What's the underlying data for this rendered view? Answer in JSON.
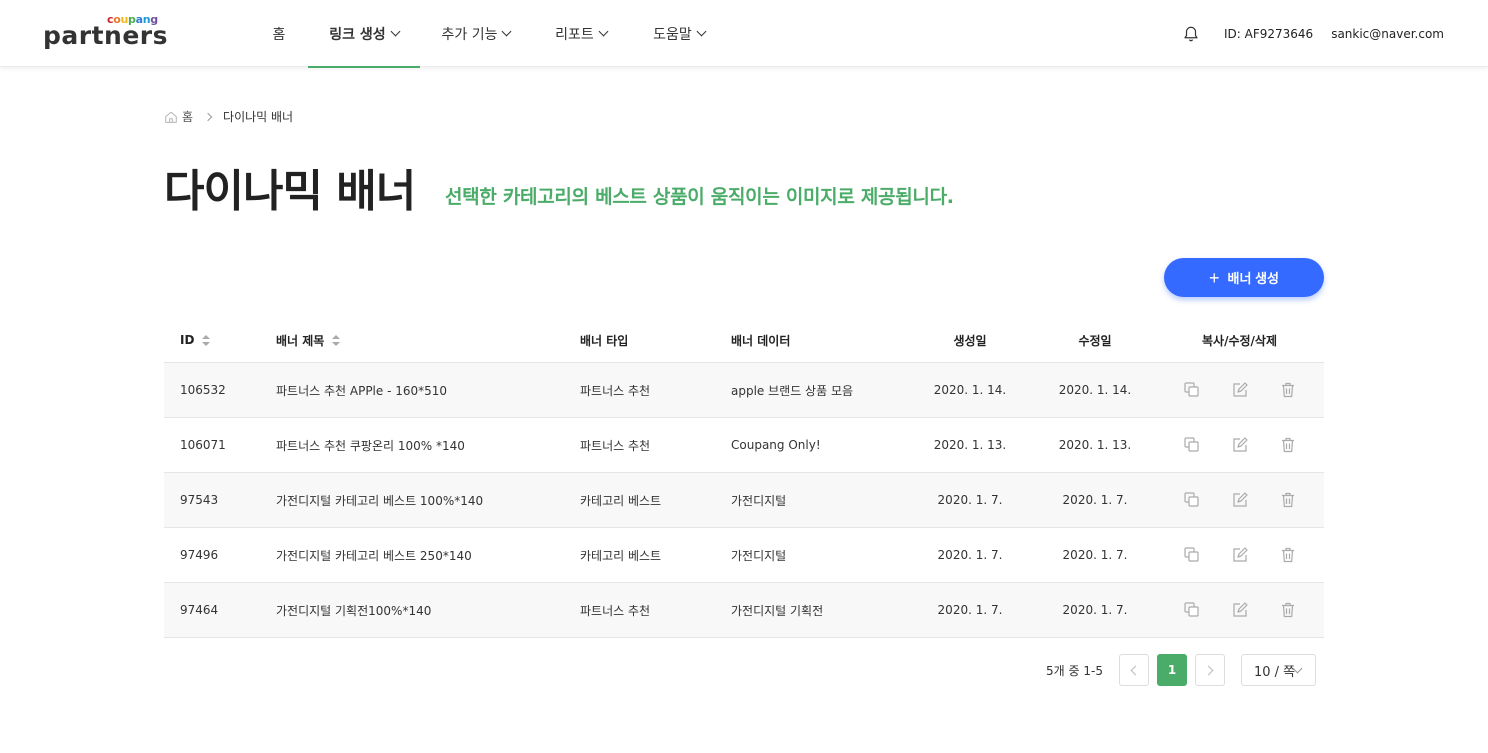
{
  "header": {
    "logo_small": [
      "c",
      "o",
      "u",
      "p",
      "a",
      "n",
      "g"
    ],
    "logo_big": "partners",
    "nav": [
      {
        "label": "홈",
        "has_chevron": false
      },
      {
        "label": "링크 생성",
        "has_chevron": true,
        "active": true
      },
      {
        "label": "추가 기능",
        "has_chevron": true
      },
      {
        "label": "리포트",
        "has_chevron": true
      },
      {
        "label": "도움말",
        "has_chevron": true
      }
    ],
    "user_id": "ID: AF9273646",
    "email": "sankic@naver.com"
  },
  "breadcrumb": {
    "home": "홈",
    "current": "다이나믹 배너"
  },
  "page": {
    "title": "다이나믹 배너",
    "subtitle": "선택한 카테고리의 베스트 상품이 움직이는 이미지로 제공됩니다.",
    "create_button": "배너 생성"
  },
  "table": {
    "columns": {
      "id": "ID",
      "title": "배너 제목",
      "type": "배너 타입",
      "data": "배너 데이터",
      "created": "생성일",
      "modified": "수정일",
      "actions": "복사/수정/삭제"
    },
    "rows": [
      {
        "id": "106532",
        "title": "파트너스 추천 APPle - 160*510",
        "type": "파트너스 추천",
        "data": "apple 브랜드 상품 모음",
        "created": "2020. 1. 14.",
        "modified": "2020. 1. 14."
      },
      {
        "id": "106071",
        "title": "파트너스 추천 쿠팡온리 100% *140",
        "type": "파트너스 추천",
        "data": "Coupang Only!",
        "created": "2020. 1. 13.",
        "modified": "2020. 1. 13."
      },
      {
        "id": "97543",
        "title": "가전디지털 카테고리 베스트 100%*140",
        "type": "카테고리 베스트",
        "data": "가전디지털",
        "created": "2020. 1. 7.",
        "modified": "2020. 1. 7."
      },
      {
        "id": "97496",
        "title": "가전디지털 카테고리 베스트 250*140",
        "type": "카테고리 베스트",
        "data": "가전디지털",
        "created": "2020. 1. 7.",
        "modified": "2020. 1. 7."
      },
      {
        "id": "97464",
        "title": "가전디지털 기획전100%*140",
        "type": "파트너스 추천",
        "data": "가전디지털 기획전",
        "created": "2020. 1. 7.",
        "modified": "2020. 1. 7."
      }
    ]
  },
  "pagination": {
    "summary": "5개 중 1-5",
    "current_page": "1",
    "per_page": "10 / 쪽"
  },
  "colors": {
    "accent_green": "#4bac6a",
    "primary_blue": "#346aff"
  },
  "icons": [
    "bell-icon",
    "home-icon",
    "copy-icon",
    "edit-icon",
    "trash-icon"
  ]
}
